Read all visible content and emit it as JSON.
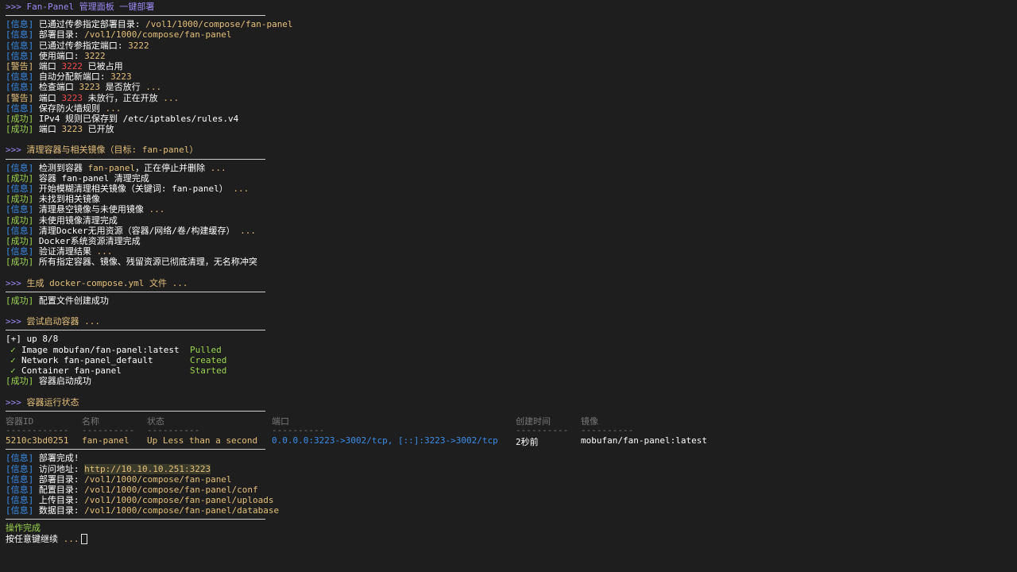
{
  "header1": {
    "prompt": ">>> ",
    "title": "Fan-Panel 管理面板 一键部署"
  },
  "block1": [
    {
      "tag": "[信息]",
      "type": "info",
      "parts": [
        {
          "t": " 已通过传参指定部署目录: ",
          "c": "white"
        },
        {
          "t": "/vol1/1000/compose/fan-panel",
          "c": "yellow"
        }
      ]
    },
    {
      "tag": "[信息]",
      "type": "info",
      "parts": [
        {
          "t": " 部署目录: ",
          "c": "white"
        },
        {
          "t": "/vol1/1000/compose/fan-panel",
          "c": "yellow"
        }
      ]
    },
    {
      "tag": "[信息]",
      "type": "info",
      "parts": [
        {
          "t": " 已通过传参指定端口: ",
          "c": "white"
        },
        {
          "t": "3222",
          "c": "yellow"
        }
      ]
    },
    {
      "tag": "[信息]",
      "type": "info",
      "parts": [
        {
          "t": " 使用端口: ",
          "c": "white"
        },
        {
          "t": "3222",
          "c": "yellow"
        }
      ]
    },
    {
      "tag": "[警告]",
      "type": "warn",
      "parts": [
        {
          "t": " 端口 ",
          "c": "white"
        },
        {
          "t": "3222",
          "c": "red"
        },
        {
          "t": " 已被占用",
          "c": "white"
        }
      ]
    },
    {
      "tag": "[信息]",
      "type": "info",
      "parts": [
        {
          "t": " 自动分配新端口: ",
          "c": "white"
        },
        {
          "t": "3223",
          "c": "yellow"
        }
      ]
    },
    {
      "tag": "[信息]",
      "type": "info",
      "parts": [
        {
          "t": " 检查端口 ",
          "c": "white"
        },
        {
          "t": "3223",
          "c": "yellow"
        },
        {
          "t": " 是否放行 ",
          "c": "white"
        },
        {
          "t": "...",
          "c": "yellow"
        }
      ]
    },
    {
      "tag": "[警告]",
      "type": "warn",
      "parts": [
        {
          "t": " 端口 ",
          "c": "white"
        },
        {
          "t": "3223",
          "c": "red"
        },
        {
          "t": " 未放行，正在开放 ",
          "c": "white"
        },
        {
          "t": "...",
          "c": "yellow"
        }
      ]
    },
    {
      "tag": "[信息]",
      "type": "info",
      "parts": [
        {
          "t": " 保存防火墙规则 ",
          "c": "white"
        },
        {
          "t": "...",
          "c": "yellow"
        }
      ]
    },
    {
      "tag": "[成功]",
      "type": "ok",
      "parts": [
        {
          "t": " IPv4 规则已保存到 /etc/iptables/rules.v4",
          "c": "white"
        }
      ]
    },
    {
      "tag": "[成功]",
      "type": "ok",
      "parts": [
        {
          "t": " 端口 ",
          "c": "white"
        },
        {
          "t": "3223",
          "c": "yellow"
        },
        {
          "t": " 已开放",
          "c": "white"
        }
      ]
    }
  ],
  "header2": {
    "prompt": ">>> ",
    "title": "清理容器与相关镜像（目标: fan-panel）"
  },
  "block2": [
    {
      "tag": "[信息]",
      "type": "info",
      "parts": [
        {
          "t": " 检测到容器 ",
          "c": "white"
        },
        {
          "t": "fan-panel",
          "c": "yellow"
        },
        {
          "t": "，正在停止并删除 ",
          "c": "white"
        },
        {
          "t": "...",
          "c": "yellow"
        }
      ]
    },
    {
      "tag": "[成功]",
      "type": "ok",
      "parts": [
        {
          "t": " 容器 fan-panel 清理完成",
          "c": "white"
        }
      ]
    },
    {
      "tag": "[信息]",
      "type": "info",
      "parts": [
        {
          "t": " 开始模糊清理相关镜像（关键词: fan-panel） ",
          "c": "white"
        },
        {
          "t": "...",
          "c": "yellow"
        }
      ]
    },
    {
      "tag": "[成功]",
      "type": "ok",
      "parts": [
        {
          "t": " 未找到相关镜像",
          "c": "white"
        }
      ]
    },
    {
      "tag": "[信息]",
      "type": "info",
      "parts": [
        {
          "t": " 清理悬空镜像与未使用镜像 ",
          "c": "white"
        },
        {
          "t": "...",
          "c": "yellow"
        }
      ]
    },
    {
      "tag": "[成功]",
      "type": "ok",
      "parts": [
        {
          "t": " 未使用镜像清理完成",
          "c": "white"
        }
      ]
    },
    {
      "tag": "[信息]",
      "type": "info",
      "parts": [
        {
          "t": " 清理Docker无用资源（容器/网络/卷/构建缓存） ",
          "c": "white"
        },
        {
          "t": "...",
          "c": "yellow"
        }
      ]
    },
    {
      "tag": "[成功]",
      "type": "ok",
      "parts": [
        {
          "t": " Docker系统资源清理完成",
          "c": "white"
        }
      ]
    },
    {
      "tag": "[信息]",
      "type": "info",
      "parts": [
        {
          "t": " 验证清理结果 ",
          "c": "white"
        },
        {
          "t": "...",
          "c": "yellow"
        }
      ]
    },
    {
      "tag": "[成功]",
      "type": "ok",
      "parts": [
        {
          "t": " 所有指定容器、镜像、残留资源已彻底清理，无名称冲突",
          "c": "white"
        }
      ]
    }
  ],
  "header3": {
    "prompt": ">>> ",
    "title": "生成 docker-compose.yml 文件 ..."
  },
  "block3": [
    {
      "tag": "[成功]",
      "type": "ok",
      "parts": [
        {
          "t": " 配置文件创建成功",
          "c": "white"
        }
      ]
    }
  ],
  "header4": {
    "prompt": ">>> ",
    "title": "尝试启动容器 ..."
  },
  "block4": {
    "up_line": "[+] up 8/8",
    "items": [
      {
        "check": "✓",
        "name": "Image mobufan/fan-panel:latest",
        "status": "Pulled"
      },
      {
        "check": "✓",
        "name": "Network fan-panel_default",
        "status": "Created"
      },
      {
        "check": "✓",
        "name": "Container fan-panel",
        "status": "Started"
      }
    ],
    "done": {
      "tag": "[成功]",
      "text": " 容器启动成功"
    }
  },
  "header5": {
    "prompt": ">>> ",
    "title": "容器运行状态"
  },
  "status_table": {
    "headers": [
      "容器ID",
      "名称",
      "状态",
      "端口",
      "创建时间",
      "镜像"
    ],
    "dashes": [
      "------------",
      "----------",
      "----------",
      "----------",
      "----------",
      "----------"
    ],
    "row": [
      "5210c3bd0251",
      "fan-panel",
      "Up Less than a second",
      "0.0.0.0:3223->3002/tcp, [::]:3223->3002/tcp",
      "2秒前",
      "mobufan/fan-panel:latest"
    ]
  },
  "block6": [
    {
      "tag": "[信息]",
      "type": "info",
      "parts": [
        {
          "t": " 部署完成!",
          "c": "white"
        }
      ]
    },
    {
      "tag": "[信息]",
      "type": "info",
      "parts": [
        {
          "t": " 访问地址: ",
          "c": "white"
        },
        {
          "t": "http://10.10.10.251:3223",
          "c": "url"
        }
      ]
    },
    {
      "tag": "[信息]",
      "type": "info",
      "parts": [
        {
          "t": " 部署目录: ",
          "c": "white"
        },
        {
          "t": "/vol1/1000/compose/fan-panel",
          "c": "yellow"
        }
      ]
    },
    {
      "tag": "[信息]",
      "type": "info",
      "parts": [
        {
          "t": " 配置目录: ",
          "c": "white"
        },
        {
          "t": "/vol1/1000/compose/fan-panel/conf",
          "c": "yellow"
        }
      ]
    },
    {
      "tag": "[信息]",
      "type": "info",
      "parts": [
        {
          "t": " 上传目录: ",
          "c": "white"
        },
        {
          "t": "/vol1/1000/compose/fan-panel/uploads",
          "c": "yellow"
        }
      ]
    },
    {
      "tag": "[信息]",
      "type": "info",
      "parts": [
        {
          "t": " 数据目录: ",
          "c": "white"
        },
        {
          "t": "/vol1/1000/compose/fan-panel/database",
          "c": "yellow"
        }
      ]
    }
  ],
  "footer": {
    "done": "操作完成",
    "prompt": "按任意键继续",
    "dots": " ..."
  }
}
